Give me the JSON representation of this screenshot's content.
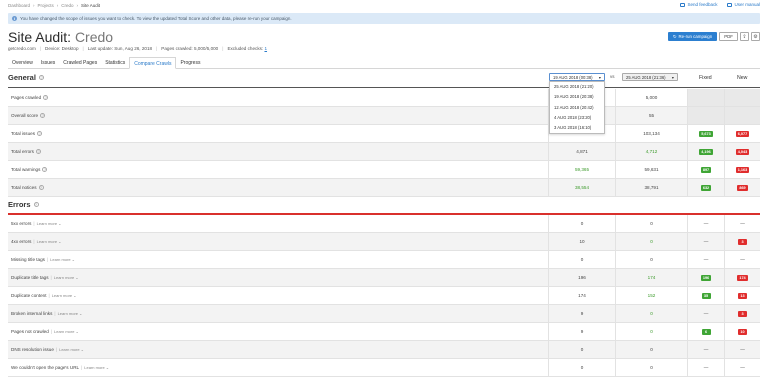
{
  "breadcrumbs": [
    "Dashboard",
    "Projects",
    "Credo",
    "Site Audit"
  ],
  "top_links": {
    "feedback": "Send feedback",
    "manual": "User manual"
  },
  "notice": {
    "icon": "info-icon",
    "text": "You have changed the scope of issues you want to check. To view the updated Total Score and other data, please re-run your campaign."
  },
  "title": {
    "prefix": "Site Audit:",
    "name": "Credo"
  },
  "meta": {
    "domain": "getcredo.com",
    "device": "Device: Desktop",
    "last_update": "Last update: Sun, Aug 26, 2018",
    "pages_crawled": "Pages crawled: 5,000/5,000",
    "excluded_label": "Excluded checks:",
    "excluded_value": "1"
  },
  "buttons": {
    "rerun": "Re-run campaign",
    "pdf": "PDF"
  },
  "tabs": [
    "Overview",
    "Issues",
    "Crawled Pages",
    "Statistics",
    "Compare Crawls",
    "Progress"
  ],
  "general": {
    "title": "General",
    "date1": "19 AUG 2018 (00:38)",
    "vs": "vs",
    "date2": "25 AUG 2018 (21:36)",
    "fixed": "Fixed",
    "new": "New",
    "menu": [
      "25 AUG 2018 (21:20)",
      "19 AUG 2018 (20:38)",
      "12 AUG 2018 (20:42)",
      "4 AUG 2018 (23:20)",
      "3 AUG 2018 (16:10)"
    ],
    "rows": [
      {
        "label": "Pages crawled",
        "c2": "5,000"
      },
      {
        "label": "Overall score",
        "c2": "55"
      },
      {
        "label": "Total issues",
        "c2": "103,134",
        "fixed": "5,673",
        "new": "6,077"
      },
      {
        "label": "Total errors",
        "c1": "4,871",
        "c2": "4,712",
        "fixed": "4,196",
        "new": "4,043"
      },
      {
        "label": "Total warnings",
        "c1": "59,365",
        "c2": "59,631",
        "fixed": "897",
        "new": "1,163"
      },
      {
        "label": "Total notices",
        "c1": "38,554",
        "c2": "38,791",
        "fixed": "632",
        "new": "869"
      }
    ]
  },
  "errors": {
    "title": "Errors",
    "learn_more": "Learn more",
    "dash": "—",
    "rows": [
      {
        "label": "5xx errors",
        "c1": "0",
        "c2": "0"
      },
      {
        "label": "4xx errors",
        "c1": "10",
        "c2": "0",
        "new": "3"
      },
      {
        "label": "Missing title tags",
        "c1": "0",
        "c2": "0"
      },
      {
        "label": "Duplicate title tags",
        "c1": "196",
        "c2": "174",
        "fixed": "196",
        "new": "174"
      },
      {
        "label": "Duplicate content",
        "c1": "174",
        "c2": "152",
        "fixed": "35",
        "new": "13"
      },
      {
        "label": "Broken internal links",
        "c1": "9",
        "c2": "0",
        "new": "3"
      },
      {
        "label": "Pages not crawled",
        "c1": "9",
        "c2": "0",
        "fixed": "6",
        "new": "10"
      },
      {
        "label": "DNS resolution issue",
        "c1": "0",
        "c2": "0"
      },
      {
        "label": "We couldn't open the page's URL",
        "c1": "0",
        "c2": "0"
      }
    ]
  }
}
